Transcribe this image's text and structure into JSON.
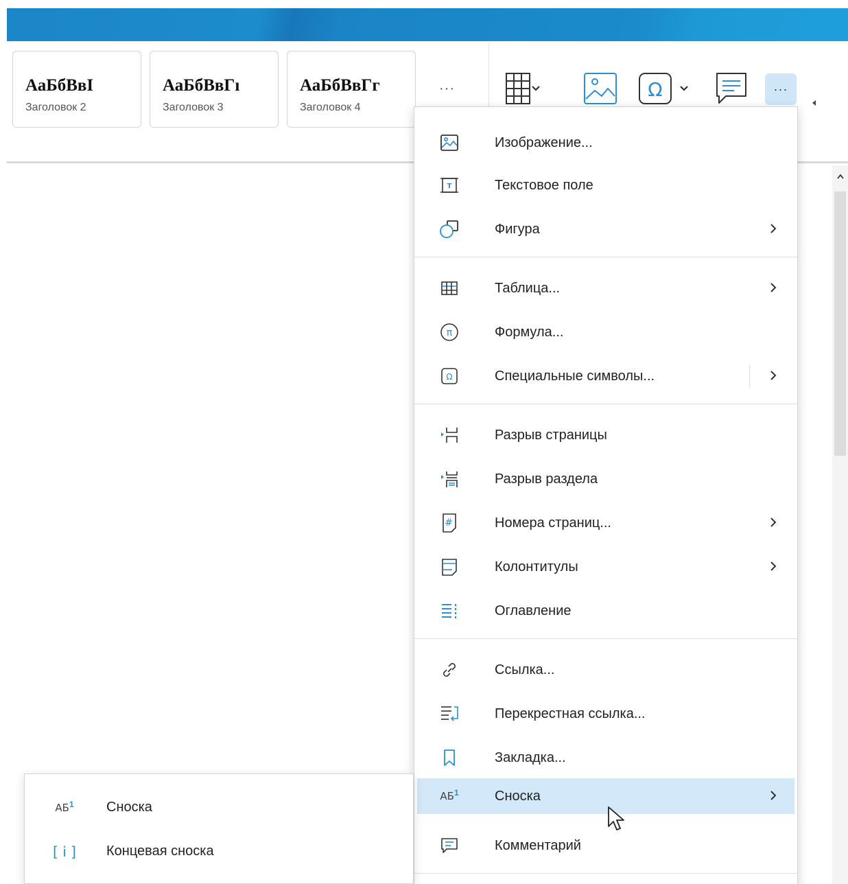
{
  "ribbon": {
    "styles": [
      {
        "sample": "АаБбВвI",
        "caption": "Заголовок 2"
      },
      {
        "sample": "АаБбВвГı",
        "caption": "Заголовок 3"
      },
      {
        "sample": "АаБбВвГг",
        "caption": "Заголовок 4"
      }
    ],
    "more_styles": "···",
    "more_button": "···",
    "icons": [
      "table-icon",
      "image-icon",
      "omega-icon",
      "comment-icon",
      "more-icon"
    ]
  },
  "menu": {
    "items": [
      {
        "label": "Изображение...",
        "icon": "image-icon",
        "submenu": false
      },
      {
        "label": "Текстовое поле",
        "icon": "text-box-icon",
        "submenu": false
      },
      {
        "label": "Фигура",
        "icon": "shape-icon",
        "submenu": true
      },
      {
        "label": "Таблица...",
        "icon": "table-icon",
        "submenu": true
      },
      {
        "label": "Формула...",
        "icon": "formula-icon",
        "submenu": false
      },
      {
        "label": "Специальные символы...",
        "icon": "omega-icon",
        "submenu": true
      },
      {
        "label": "Разрыв страницы",
        "icon": "page-break-icon",
        "submenu": false
      },
      {
        "label": "Разрыв раздела",
        "icon": "section-break-icon",
        "submenu": false
      },
      {
        "label": "Номера страниц...",
        "icon": "page-number-icon",
        "submenu": true
      },
      {
        "label": "Колонтитулы",
        "icon": "header-footer-icon",
        "submenu": true
      },
      {
        "label": "Оглавление",
        "icon": "toc-icon",
        "submenu": false
      },
      {
        "label": "Ссылка...",
        "icon": "link-icon",
        "submenu": false
      },
      {
        "label": "Перекрестная ссылка...",
        "icon": "cross-reference-icon",
        "submenu": false
      },
      {
        "label": "Закладка...",
        "icon": "bookmark-icon",
        "submenu": false
      },
      {
        "label": "Сноска",
        "icon": "footnote-icon",
        "submenu": true,
        "active": true
      },
      {
        "label": "Комментарий",
        "icon": "comment-icon",
        "submenu": false
      }
    ]
  },
  "submenu": {
    "items": [
      {
        "label": "Сноска",
        "icon": "footnote-icon"
      },
      {
        "label": "Концевая сноска",
        "icon": "endnote-icon"
      }
    ]
  },
  "icon_glyphs": {
    "footnote": "АБ",
    "footnote_sup": "1",
    "endnote": "[ i ]",
    "page_number": "#"
  },
  "colors": {
    "accent": "#1b86c8",
    "icon_blue": "#2a8fd4",
    "active_item": "#d3e8f8",
    "more_button_bg": "#cfe6f8"
  }
}
